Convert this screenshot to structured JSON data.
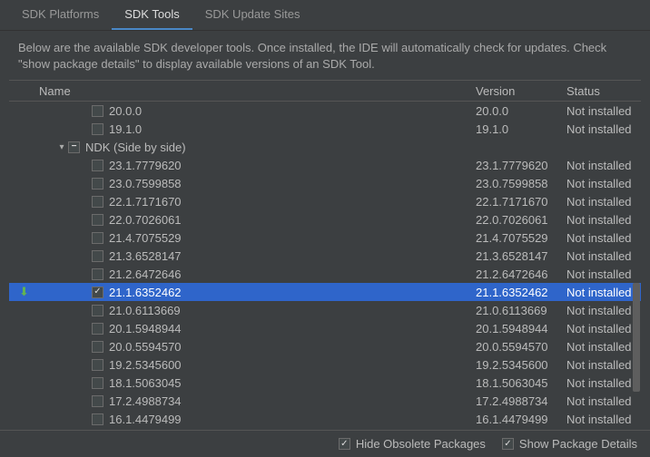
{
  "tabs": {
    "platforms": "SDK Platforms",
    "tools": "SDK Tools",
    "updates": "SDK Update Sites",
    "active": 1
  },
  "description": "Below are the available SDK developer tools. Once installed, the IDE will automatically check for updates. Check \"show package details\" to display available versions of an SDK Tool.",
  "columns": {
    "name": "Name",
    "version": "Version",
    "status": "Status"
  },
  "group": {
    "label": "NDK (Side by side)"
  },
  "rows": [
    {
      "indent": 2,
      "name": "20.0.0",
      "version": "20.0.0",
      "status": "Not installed",
      "checked": false
    },
    {
      "indent": 2,
      "name": "19.1.0",
      "version": "19.1.0",
      "status": "Not installed",
      "checked": false
    },
    {
      "group": true,
      "indent": 1,
      "name": "NDK (Side by side)",
      "expanded": true,
      "mixed": true
    },
    {
      "indent": 2,
      "name": "23.1.7779620",
      "version": "23.1.7779620",
      "status": "Not installed",
      "checked": false
    },
    {
      "indent": 2,
      "name": "23.0.7599858",
      "version": "23.0.7599858",
      "status": "Not installed",
      "checked": false
    },
    {
      "indent": 2,
      "name": "22.1.7171670",
      "version": "22.1.7171670",
      "status": "Not installed",
      "checked": false
    },
    {
      "indent": 2,
      "name": "22.0.7026061",
      "version": "22.0.7026061",
      "status": "Not installed",
      "checked": false
    },
    {
      "indent": 2,
      "name": "21.4.7075529",
      "version": "21.4.7075529",
      "status": "Not installed",
      "checked": false
    },
    {
      "indent": 2,
      "name": "21.3.6528147",
      "version": "21.3.6528147",
      "status": "Not installed",
      "checked": false
    },
    {
      "indent": 2,
      "name": "21.2.6472646",
      "version": "21.2.6472646",
      "status": "Not installed",
      "checked": false
    },
    {
      "indent": 2,
      "name": "21.1.6352462",
      "version": "21.1.6352462",
      "status": "Not installed",
      "checked": true,
      "selected": true,
      "download": true
    },
    {
      "indent": 2,
      "name": "21.0.6113669",
      "version": "21.0.6113669",
      "status": "Not installed",
      "checked": false
    },
    {
      "indent": 2,
      "name": "20.1.5948944",
      "version": "20.1.5948944",
      "status": "Not installed",
      "checked": false
    },
    {
      "indent": 2,
      "name": "20.0.5594570",
      "version": "20.0.5594570",
      "status": "Not installed",
      "checked": false
    },
    {
      "indent": 2,
      "name": "19.2.5345600",
      "version": "19.2.5345600",
      "status": "Not installed",
      "checked": false
    },
    {
      "indent": 2,
      "name": "18.1.5063045",
      "version": "18.1.5063045",
      "status": "Not installed",
      "checked": false
    },
    {
      "indent": 2,
      "name": "17.2.4988734",
      "version": "17.2.4988734",
      "status": "Not installed",
      "checked": false
    },
    {
      "indent": 2,
      "name": "16.1.4479499",
      "version": "16.1.4479499",
      "status": "Not installed",
      "checked": false
    }
  ],
  "footer": {
    "hide_obsolete": "Hide Obsolete Packages",
    "show_details": "Show Package Details",
    "hide_checked": true,
    "details_checked": true
  }
}
